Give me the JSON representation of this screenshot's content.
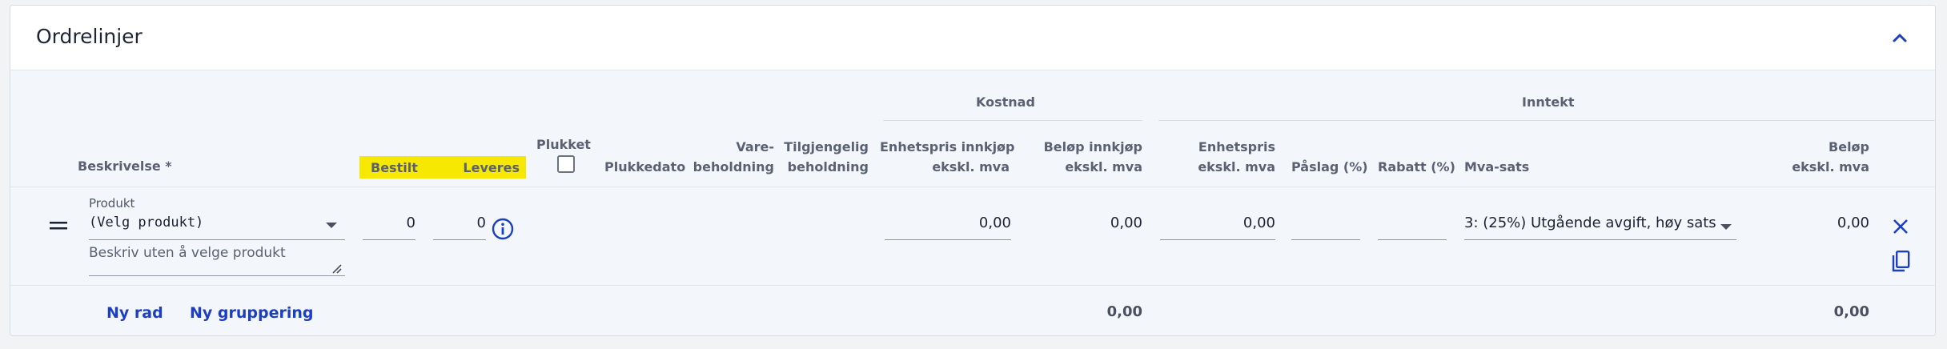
{
  "panel": {
    "title": "Ordrelinjer"
  },
  "groups": {
    "cost": "Kostnad",
    "income": "Inntekt"
  },
  "columns": {
    "description": "Beskrivelse *",
    "ordered": "Bestilt",
    "delivered": "Leveres",
    "picked": "Plukket",
    "pick_date": "Plukkedato",
    "stock_1": "Vare-",
    "stock_2": "beholdning",
    "available_1": "Tilgjengelig",
    "available_2": "beholdning",
    "unit_cost_1": "Enhetspris innkjøp",
    "unit_cost_2": "ekskl. mva",
    "cost_amount_1": "Beløp innkjøp",
    "cost_amount_2": "ekskl. mva",
    "unit_price_1": "Enhetspris",
    "unit_price_2": "ekskl. mva",
    "markup": "Påslag (%)",
    "discount": "Rabatt (%)",
    "vat": "Mva-sats",
    "amount_1": "Beløp",
    "amount_2": "ekskl. mva"
  },
  "row": {
    "product_label": "Produkt",
    "product_value": "(Velg produkt)",
    "description_placeholder": "Beskriv uten å velge produkt",
    "ordered": "0",
    "delivered": "0",
    "unit_cost": "0,00",
    "cost_amount": "0,00",
    "unit_price": "0,00",
    "markup": "",
    "discount": "",
    "vat": "3: (25%) Utgående avgift, høy sats",
    "amount": "0,00"
  },
  "footer": {
    "new_row": "Ny rad",
    "new_group": "Ny gruppering",
    "cost_total": "0,00",
    "amount_total": "0,00"
  },
  "colors": {
    "accent": "#1d3fbf",
    "highlight": "#f6e800"
  }
}
